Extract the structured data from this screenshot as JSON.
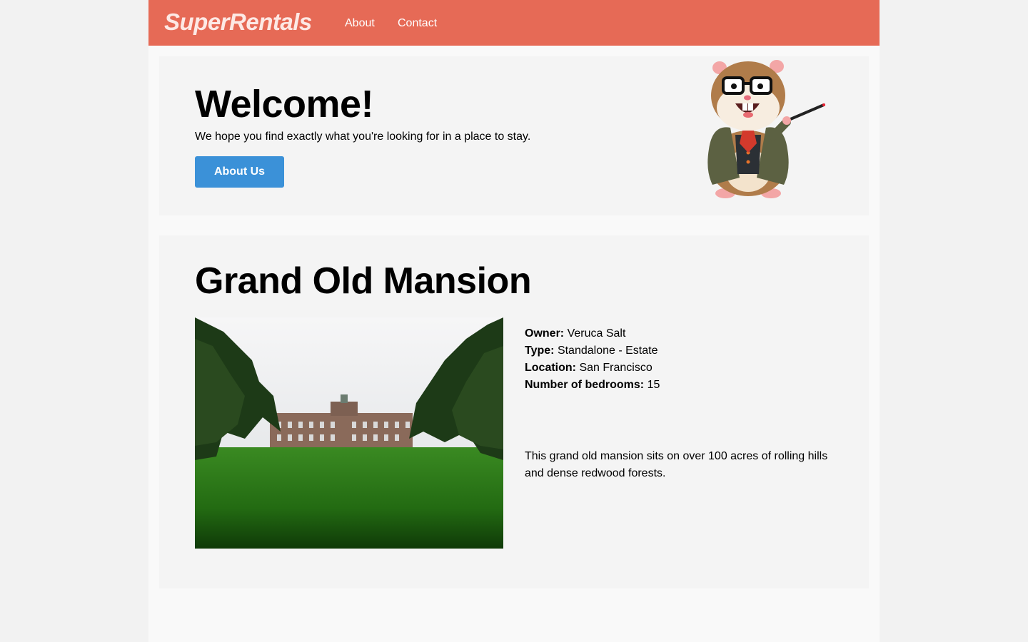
{
  "header": {
    "brand": "SuperRentals",
    "nav": {
      "about": "About",
      "contact": "Contact"
    }
  },
  "welcome": {
    "title": "Welcome!",
    "subtitle": "We hope you find exactly what you're looking for in a place to stay.",
    "button": "About Us",
    "mascot_icon": "tomster-mascot"
  },
  "rental": {
    "title": "Grand Old Mansion",
    "image_icon": "mansion-photo",
    "fields": {
      "owner_label": "Owner:",
      "owner": "Veruca Salt",
      "type_label": "Type:",
      "type": "Standalone - Estate",
      "location_label": "Location:",
      "location": "San Francisco",
      "bedrooms_label": "Number of bedrooms:",
      "bedrooms": "15"
    },
    "description": "This grand old mansion sits on over 100 acres of rolling hills and dense redwood forests."
  },
  "colors": {
    "header": "#e66a56",
    "button": "#3b91d8",
    "panel": "#f4f4f4"
  }
}
